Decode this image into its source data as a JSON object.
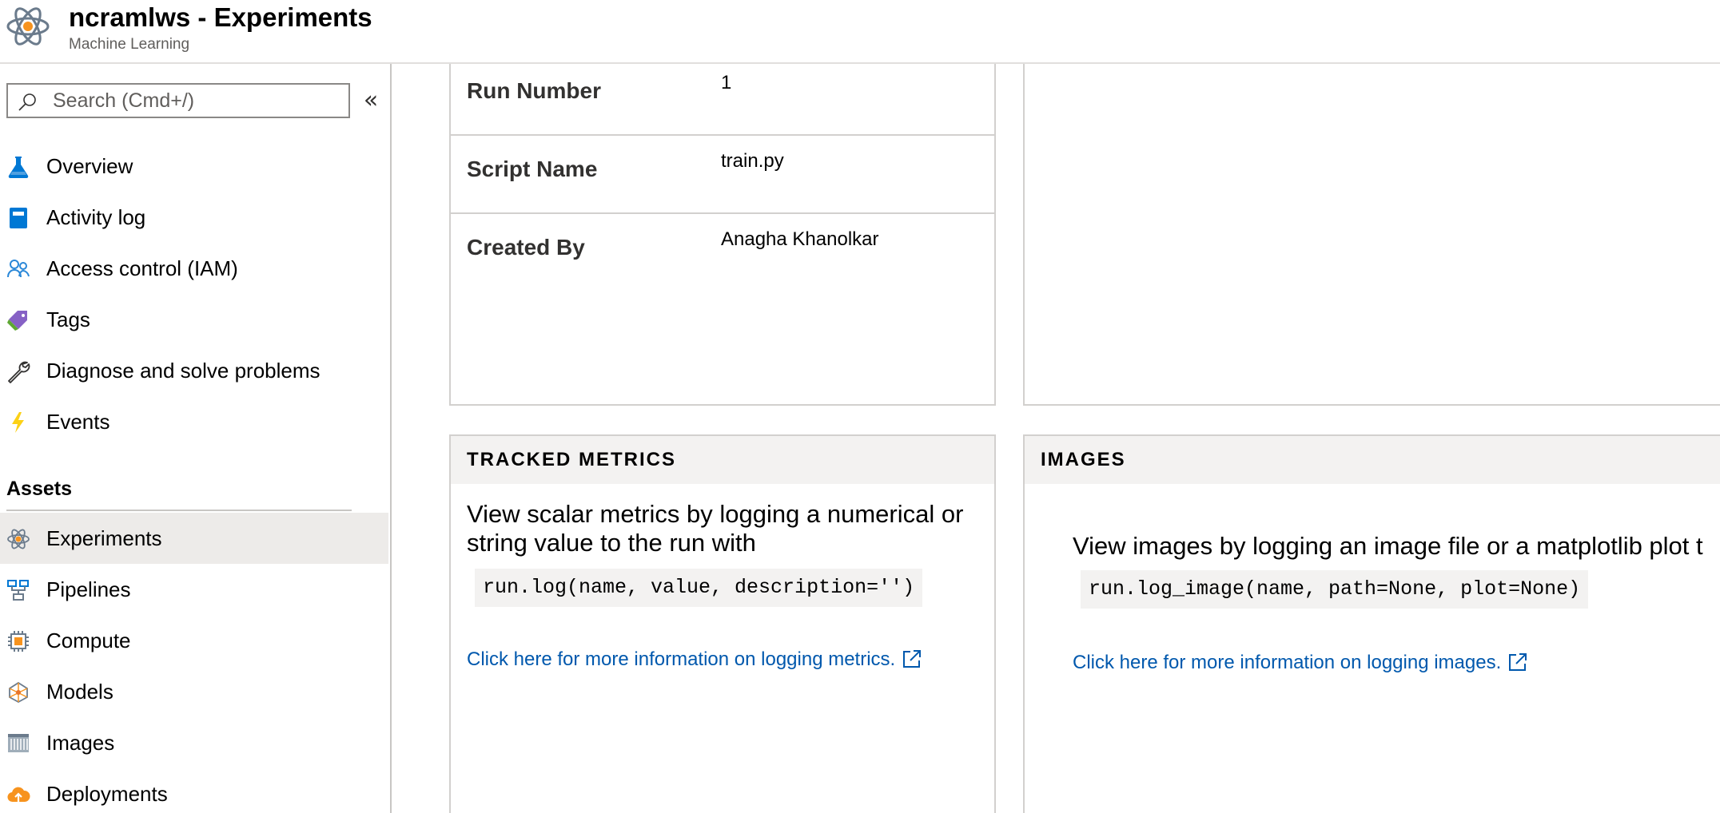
{
  "header": {
    "title": "ncramlws - Experiments",
    "subtitle": "Machine Learning",
    "icon": "ml-atom-icon"
  },
  "sidebar": {
    "search": {
      "placeholder": "Search (Cmd+/)",
      "value": ""
    },
    "collapse_label": "«",
    "items": [
      {
        "label": "Overview",
        "icon": "flask-icon"
      },
      {
        "label": "Activity log",
        "icon": "activity-log-icon"
      },
      {
        "label": "Access control (IAM)",
        "icon": "people-icon"
      },
      {
        "label": "Tags",
        "icon": "tag-icon"
      },
      {
        "label": "Diagnose and solve problems",
        "icon": "wrench-icon"
      },
      {
        "label": "Events",
        "icon": "lightning-icon"
      }
    ],
    "assets_title": "Assets",
    "assets": [
      {
        "label": "Experiments",
        "icon": "atom-icon",
        "selected": true
      },
      {
        "label": "Pipelines",
        "icon": "pipeline-icon"
      },
      {
        "label": "Compute",
        "icon": "chip-icon"
      },
      {
        "label": "Models",
        "icon": "model-icon"
      },
      {
        "label": "Images",
        "icon": "container-image-icon"
      },
      {
        "label": "Deployments",
        "icon": "cloud-upload-icon"
      }
    ]
  },
  "details": {
    "rows": [
      {
        "key": "Run Number",
        "value": "1"
      },
      {
        "key": "Script Name",
        "value": "train.py"
      },
      {
        "key": "Created By",
        "value": "Anagha Khanolkar"
      }
    ]
  },
  "metrics_card": {
    "title": "TRACKED METRICS",
    "description": "View scalar metrics by logging a numerical or string value to the run with",
    "code": "run.log(name, value, description='')",
    "link": "Click here for more information on logging metrics."
  },
  "images_card": {
    "title": "IMAGES",
    "description": "View images by logging an image file or a matplotlib plot t",
    "code": "run.log_image(name, path=None, plot=None)",
    "link": "Click here for more information on logging images."
  },
  "colors": {
    "link": "#0058ad",
    "selected_bg": "#edebe9",
    "card_header_bg": "#f3f2f1"
  }
}
